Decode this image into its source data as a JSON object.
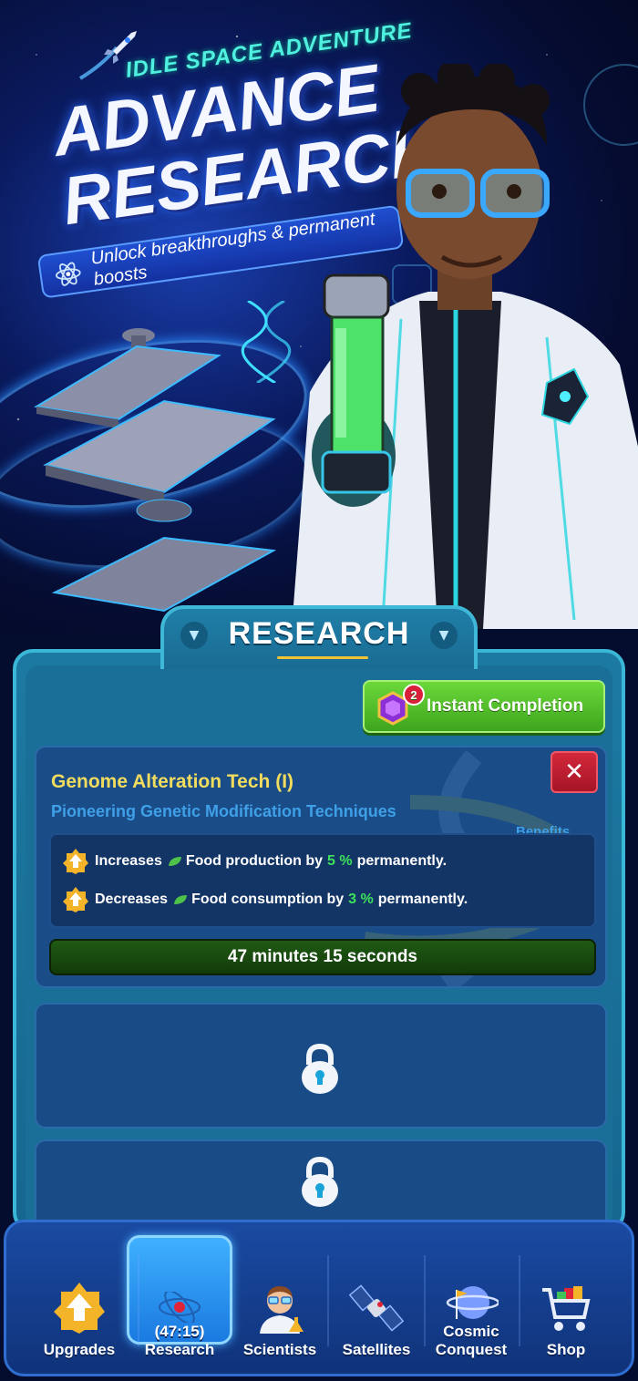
{
  "banner": {
    "kicker": "IDLE SPACE ADVENTURE",
    "title_line1": "ADVANCE",
    "title_line2": "RESEARCH",
    "tagline": "Unlock breakthroughs & permanent boosts"
  },
  "research_header": {
    "title": "RESEARCH"
  },
  "instant_completion": {
    "label": "Instant Completion",
    "gem_cost": "2"
  },
  "active_research": {
    "name": "Genome Alteration Tech (I)",
    "description": "Pioneering Genetic Modification Techniques",
    "benefits_label": "Benefits",
    "close_icon": "✕",
    "benefits": [
      {
        "verb": "Increases",
        "resource": "Food production by",
        "value": "5 %",
        "suffix": "permanently."
      },
      {
        "verb": "Decreases",
        "resource": "Food consumption by",
        "value": "3 %",
        "suffix": "permanently."
      }
    ],
    "timer": "47 minutes 15 seconds"
  },
  "locked_slots": [
    {
      "icon": "lock-icon"
    },
    {
      "icon": "lock-icon"
    }
  ],
  "bottom_nav": {
    "items": [
      {
        "label": "Upgrades",
        "icon": "upgrade-arrow-icon"
      },
      {
        "label": "Research",
        "timer": "(47:15)",
        "icon": "atom-icon",
        "active": true
      },
      {
        "label": "Scientists",
        "icon": "scientist-icon"
      },
      {
        "label": "Satellites",
        "icon": "satellite-icon"
      },
      {
        "label_line1": "Cosmic",
        "label_line2": "Conquest",
        "icon": "planet-flag-icon"
      },
      {
        "label": "Shop",
        "icon": "shopping-cart-icon"
      }
    ]
  },
  "colors": {
    "accent_teal": "#3ab6d6",
    "button_green": "#3ea51d",
    "close_red": "#d4283b",
    "title_yellow": "#f2dc5d",
    "percent_green": "#3ee05c",
    "nav_active": "#3fb0ff"
  }
}
